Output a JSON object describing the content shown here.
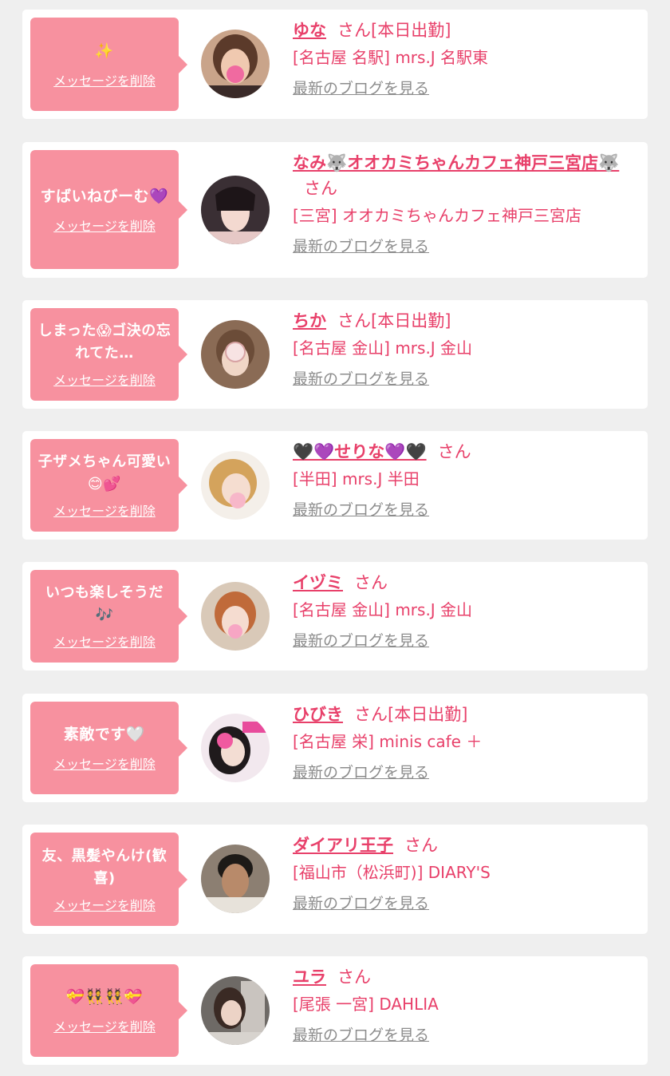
{
  "common": {
    "delete_label": "メッセージを削除",
    "san": "さん",
    "blog_label": "最新のブログを見る"
  },
  "items": [
    {
      "message": "✨",
      "name": "ゆな",
      "status": "[本日出勤]",
      "shop": "[名古屋 名駅] mrs.J 名駅東",
      "avatar": "avatar-photo"
    },
    {
      "message": "すばいねびーむ💜",
      "name": "なみ🐺オオカミちゃんカフェ神戸三宮店🐺",
      "status": "",
      "shop": "[三宮] オオカミちゃんカフェ神戸三宮店",
      "avatar": "avatar-photo"
    },
    {
      "message": "しまった😱ゴ決の忘れてた…",
      "name": "ちか",
      "status": "[本日出勤]",
      "shop": "[名古屋 金山] mrs.J 金山",
      "avatar": "avatar-photo"
    },
    {
      "message": "子ザメちゃん可愛い😊💕",
      "name": "🖤💜せりな💜🖤",
      "status": "",
      "shop": "[半田] mrs.J 半田",
      "avatar": "avatar-photo"
    },
    {
      "message": "いつも楽しそうだ🎶",
      "name": "イヅミ",
      "status": "",
      "shop": "[名古屋 金山] mrs.J 金山",
      "avatar": "avatar-photo"
    },
    {
      "message": "素敵です🤍",
      "name": "ひびき",
      "status": "[本日出勤]",
      "shop": "[名古屋 栄] minis cafe ＋",
      "avatar": "avatar-photo"
    },
    {
      "message": "友、黒髪やんけ(歓喜)",
      "name": "ダイアリ王子",
      "status": "",
      "shop": "[福山市（松浜町)] DIARY'S",
      "avatar": "avatar-photo"
    },
    {
      "message": "💝👯👯💝",
      "name": "ユラ",
      "status": "",
      "shop": "[尾張 一宮] DAHLIA",
      "avatar": "avatar-photo"
    }
  ],
  "colors": {
    "page_bg": "#efefef",
    "card_bg": "#ffffff",
    "bubble_bg": "#f7919f",
    "accent": "#e8406a",
    "link_gray": "#8c8c8c"
  }
}
